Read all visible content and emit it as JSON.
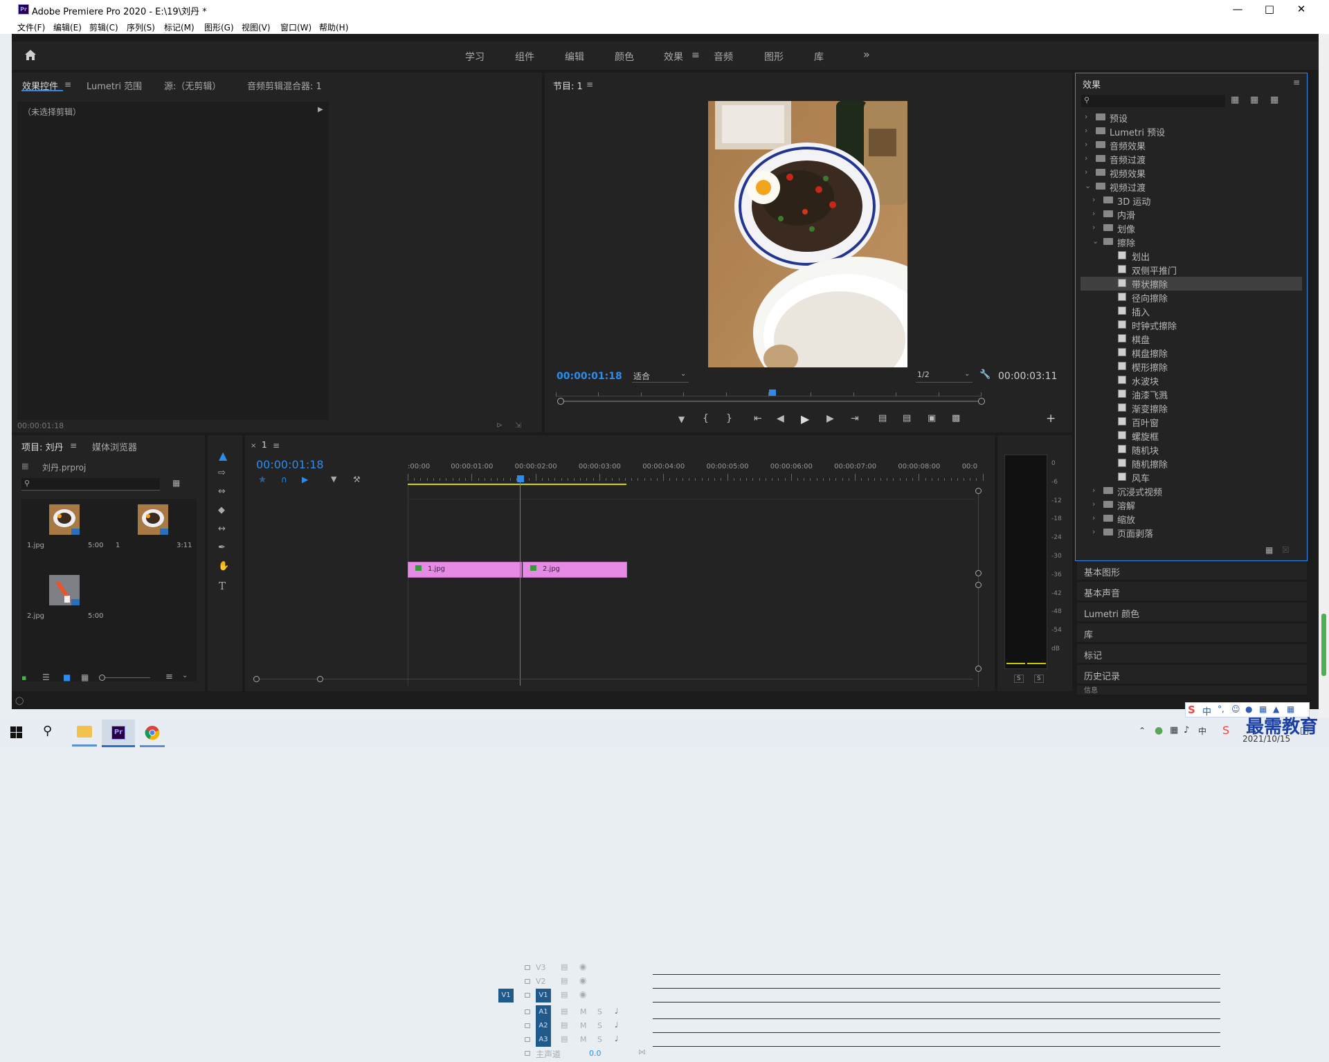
{
  "window": {
    "title": "Adobe Premiere Pro 2020 - E:\\19\\刘丹 *",
    "pr_logo": "Pr"
  },
  "menus": [
    "文件(F)",
    "编辑(E)",
    "剪辑(C)",
    "序列(S)",
    "标记(M)",
    "图形(G)",
    "视图(V)",
    "窗口(W)",
    "帮助(H)"
  ],
  "workspaces": {
    "items": [
      "学习",
      "组件",
      "编辑",
      "颜色",
      "效果",
      "音频",
      "图形",
      "库"
    ],
    "active": "效果",
    "more": "»"
  },
  "effect_controls": {
    "tabs": [
      "效果控件",
      "Lumetri 范围",
      "源:（无剪辑）",
      "音频剪辑混合器: 1"
    ],
    "no_clip": "（未选择剪辑）",
    "timecode": "00:00:01:18"
  },
  "program_monitor": {
    "tab": "节目: 1",
    "timecode": "00:00:01:18",
    "fit": "适合",
    "resolution": "1/2",
    "duration": "00:00:03:11",
    "playhead_fraction": 0.51
  },
  "effects_panel": {
    "title": "效果",
    "search_placeholder": "",
    "items": [
      {
        "label": "预设",
        "level": 0,
        "kind": "folder",
        "expanded": false
      },
      {
        "label": "Lumetri 预设",
        "level": 0,
        "kind": "folder",
        "expanded": false
      },
      {
        "label": "音频效果",
        "level": 0,
        "kind": "folder",
        "expanded": false
      },
      {
        "label": "音频过渡",
        "level": 0,
        "kind": "folder",
        "expanded": false
      },
      {
        "label": "视频效果",
        "level": 0,
        "kind": "folder",
        "expanded": false
      },
      {
        "label": "视频过渡",
        "level": 0,
        "kind": "folder",
        "expanded": true
      },
      {
        "label": "3D 运动",
        "level": 1,
        "kind": "folder",
        "expanded": false
      },
      {
        "label": "内滑",
        "level": 1,
        "kind": "folder",
        "expanded": false
      },
      {
        "label": "划像",
        "level": 1,
        "kind": "folder",
        "expanded": false
      },
      {
        "label": "擦除",
        "level": 1,
        "kind": "folder",
        "expanded": true
      },
      {
        "label": "划出",
        "level": 2,
        "kind": "effect"
      },
      {
        "label": "双侧平推门",
        "level": 2,
        "kind": "effect"
      },
      {
        "label": "带状擦除",
        "level": 2,
        "kind": "effect",
        "selected": true
      },
      {
        "label": "径向擦除",
        "level": 2,
        "kind": "effect"
      },
      {
        "label": "插入",
        "level": 2,
        "kind": "effect"
      },
      {
        "label": "时钟式擦除",
        "level": 2,
        "kind": "effect"
      },
      {
        "label": "棋盘",
        "level": 2,
        "kind": "effect"
      },
      {
        "label": "棋盘擦除",
        "level": 2,
        "kind": "effect"
      },
      {
        "label": "楔形擦除",
        "level": 2,
        "kind": "effect"
      },
      {
        "label": "水波块",
        "level": 2,
        "kind": "effect"
      },
      {
        "label": "油漆飞溅",
        "level": 2,
        "kind": "effect"
      },
      {
        "label": "渐变擦除",
        "level": 2,
        "kind": "effect"
      },
      {
        "label": "百叶窗",
        "level": 2,
        "kind": "effect"
      },
      {
        "label": "螺旋框",
        "level": 2,
        "kind": "effect"
      },
      {
        "label": "随机块",
        "level": 2,
        "kind": "effect"
      },
      {
        "label": "随机擦除",
        "level": 2,
        "kind": "effect"
      },
      {
        "label": "风车",
        "level": 2,
        "kind": "effect"
      },
      {
        "label": "沉浸式视频",
        "level": 1,
        "kind": "folder",
        "expanded": false
      },
      {
        "label": "溶解",
        "level": 1,
        "kind": "folder",
        "expanded": false
      },
      {
        "label": "缩放",
        "level": 1,
        "kind": "folder",
        "expanded": false
      },
      {
        "label": "页面剥落",
        "level": 1,
        "kind": "folder",
        "expanded": false
      }
    ],
    "collapsed_panels": [
      "基本图形",
      "基本声音",
      "Lumetri 颜色",
      "库",
      "标记",
      "历史记录",
      "信息"
    ]
  },
  "project_panel": {
    "tabs": [
      "项目: 刘丹",
      "媒体浏览器"
    ],
    "file": "刘丹.prproj",
    "items": [
      {
        "name": "1.jpg",
        "duration": "5:00"
      },
      {
        "name": "1",
        "duration": "3:11"
      },
      {
        "name": "2.jpg",
        "duration": "5:00"
      }
    ]
  },
  "timeline": {
    "tab": "1",
    "close": "×",
    "timecode": "00:00:01:18",
    "ruler": [
      ":00:00",
      "00:00:01:00",
      "00:00:02:00",
      "00:00:03:00",
      "00:00:04:00",
      "00:00:05:00",
      "00:00:06:00",
      "00:00:07:00",
      "00:00:08:00",
      "00:0"
    ],
    "video_tracks": [
      "V3",
      "V2",
      "V1"
    ],
    "audio_tracks": [
      "A1",
      "A2",
      "A3"
    ],
    "source_patch": "V1",
    "master": {
      "label": "主声道",
      "value": "0.0"
    },
    "clips": [
      {
        "name": "1.jpg",
        "color": "#e07ee0"
      },
      {
        "name": "2.jpg",
        "color": "#e07ee0"
      }
    ]
  },
  "audio_meter": {
    "scale": [
      "0",
      "-6",
      "-12",
      "-18",
      "-24",
      "-30",
      "-36",
      "-42",
      "-48",
      "-54",
      "dB"
    ],
    "solo": [
      "S",
      "S"
    ]
  },
  "taskbar": {
    "date": "2021/10/15",
    "ime": "中",
    "watermark": "最需教育"
  }
}
